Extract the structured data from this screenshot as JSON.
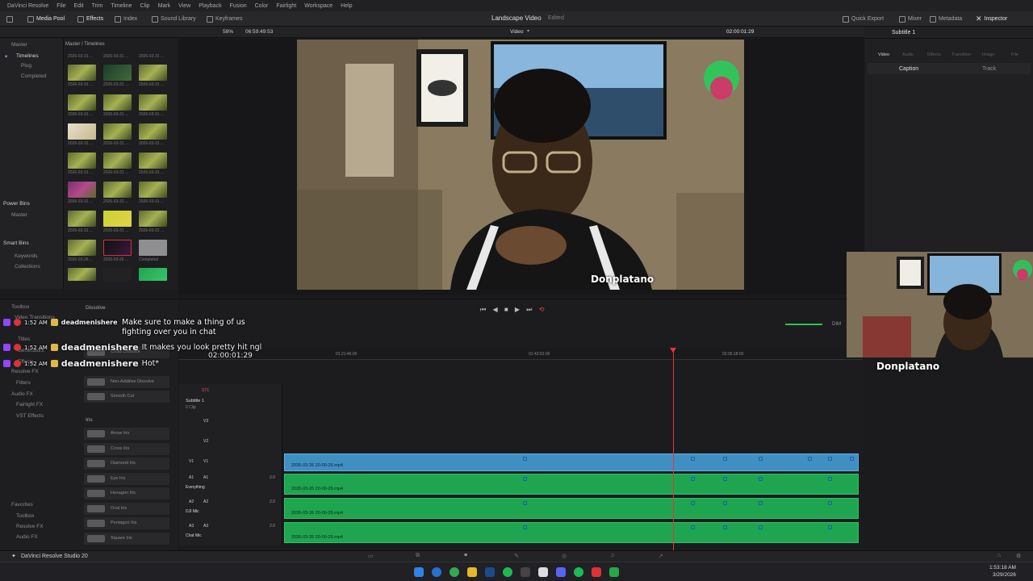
{
  "menubar": {
    "items": [
      "DaVinci Resolve",
      "File",
      "Edit",
      "Trim",
      "Timeline",
      "Clip",
      "Mark",
      "View",
      "Playback",
      "Fusion",
      "Color",
      "Fairlight",
      "Workspace",
      "Help"
    ]
  },
  "toolbar": {
    "media_pool": "Media Pool",
    "effects": "Effects",
    "index": "Index",
    "sound_library": "Sound Library",
    "keyframes": "Keyframes",
    "project_title": "Landscape Video",
    "edited": "Edited",
    "quick_export": "Quick Export",
    "mixer": "Mixer",
    "metadata": "Metadata",
    "inspector": "Inspector"
  },
  "subbar": {
    "zoom": "58%",
    "timecode_left": "06:59:49:53",
    "viewer_mode": "Video",
    "timecode_right": "02:00:01:29",
    "subtitle_label": "Subtitle 1"
  },
  "bins": {
    "master_header": "Master",
    "timelines": "Timelines",
    "plug": "Plug",
    "completed": "Completed",
    "power_bins": "Power Bins",
    "master": "Master",
    "smart_bins": "Smart Bins",
    "keywords": "Keywords",
    "collections": "Collections",
    "breadcrumb": "Master / Timelines",
    "thumb_caption": "2026-03-31 ...",
    "thumb_caption_alt": "2026-03-26 ...",
    "thumb_caption_completed": "Completed"
  },
  "inspector": {
    "tabs": [
      "Video",
      "Audio",
      "Effects",
      "Transition",
      "Image",
      "File"
    ],
    "caption_tab": "Caption",
    "track_tab": "Track"
  },
  "toolbox": {
    "header": "Toolbox",
    "dissolve": "Dissolve",
    "video_transitions": "Video Transitions",
    "titles": "Titles",
    "generators": "Generators",
    "effects": "Effects",
    "resolve_fx": "Resolve FX",
    "filters": "Filters",
    "audio_fx": "Audio FX",
    "fairlight_fx": "Fairlight FX",
    "vst_effects": "VST Effects",
    "favorites": "Favorites",
    "fav_toolbox": "Toolbox",
    "fav_resolve_fx": "Resolve FX",
    "fav_audio_fx": "Audio FX",
    "iris": "Iris",
    "items": [
      "Cross Dissolve",
      "Non-Additive Dissolve",
      "Smooth Cut",
      "Arrow Iris",
      "Cross Iris",
      "Diamond Iris",
      "Eye Iris",
      "Hexagon Iris",
      "Oval Iris",
      "Pentagon Iris",
      "Square Iris"
    ]
  },
  "timeline": {
    "ruler": [
      "01:21:46:00",
      "01:43:52:00",
      "02:05:18:00"
    ],
    "subtitle_track": "ST1",
    "subtitle_name": "Subtitle 1",
    "subtitle_clips": "0 Clip",
    "v3": "V3",
    "v2": "V2",
    "v1": "V1",
    "a1": "A1",
    "a1_name": "Everything",
    "a2": "A2",
    "a2_name": "DJI Mic",
    "a3": "A3",
    "a3_name": "Chat Mic",
    "audio_level": "2.0",
    "clip_name": "2026-03-26 20-00-26.mp4",
    "dim": "DIM"
  },
  "chat": [
    {
      "time": "1:52 AM",
      "user": "deadmenishere",
      "message": "Make sure to make a thing of us fighting over you in chat"
    },
    {
      "time": "1:52 AM",
      "user": "deadmenishere",
      "message": "It makes you look pretty hit ngl"
    },
    {
      "time": "1:52 AM",
      "user": "deadmenishere",
      "message": "Hot*"
    }
  ],
  "overlay_timecode": "02:00:01:29",
  "brand": {
    "handle": "Donplatano",
    "app": "DaVinci Resolve Studio 20"
  },
  "clock": {
    "time": "1:53:18 AM",
    "date": "3/29/2026"
  },
  "colors": {
    "video_clip": "#3f8fc3",
    "audio_clip": "#1fa550",
    "playhead": "#ee3333"
  }
}
